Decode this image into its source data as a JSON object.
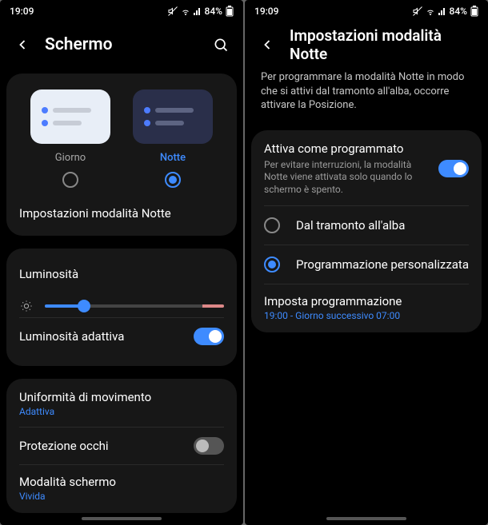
{
  "statusbar": {
    "time": "19:09",
    "battery": "84%"
  },
  "screen1": {
    "title": "Schermo",
    "themes": {
      "day": "Giorno",
      "night": "Notte"
    },
    "night_settings_label": "Impostazioni modalità Notte",
    "brightness_label": "Luminosità",
    "brightness_percent": 22,
    "adaptive_brightness_label": "Luminosità adattiva",
    "adaptive_brightness_on": true,
    "motion_label": "Uniformità di movimento",
    "motion_value": "Adattiva",
    "eye_protection_label": "Protezione occhi",
    "eye_protection_on": false,
    "screen_mode_label": "Modalità schermo",
    "screen_mode_value": "Vivida"
  },
  "screen2": {
    "title": "Impostazioni modalità Notte",
    "intro": "Per programmare la modalità Notte in modo che si attivi dal tramonto all'alba, occorre attivare la Posizione.",
    "scheduled_label": "Attiva come programmato",
    "scheduled_desc": "Per evitare interruzioni, la modalità Notte viene attivata solo quando lo schermo è spento.",
    "scheduled_on": true,
    "opt_sunset": "Dal tramonto all'alba",
    "opt_custom": "Programmazione personalizzata",
    "set_schedule_label": "Imposta programmazione",
    "set_schedule_value": "19:00 - Giorno successivo 07:00"
  }
}
